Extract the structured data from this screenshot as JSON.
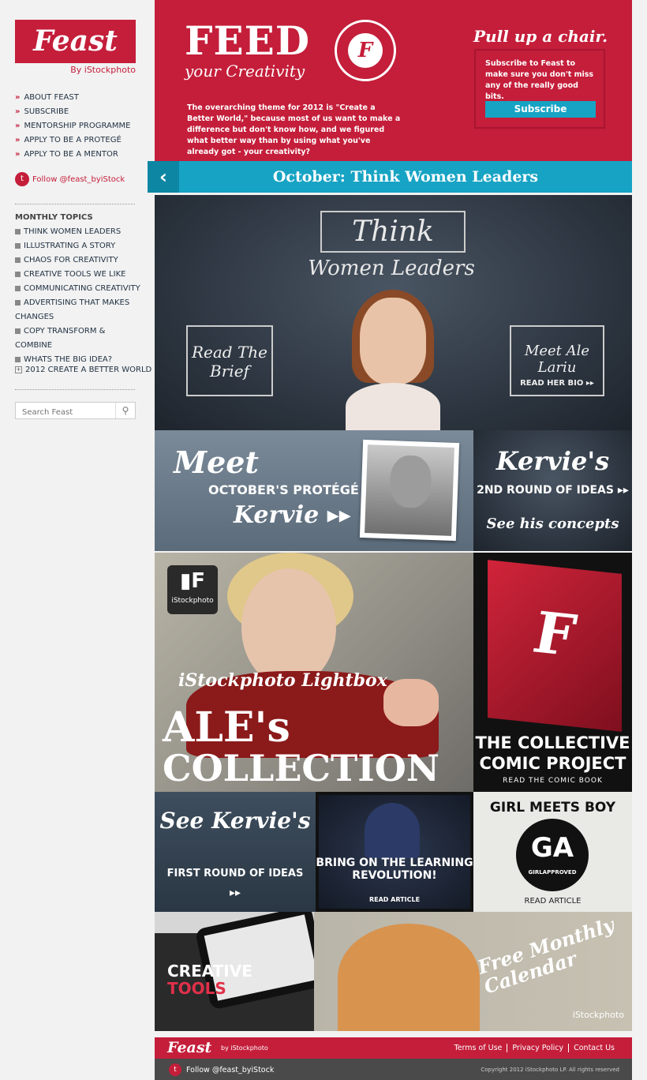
{
  "sidebar": {
    "logo": "Feast",
    "logo_sub": "By iStockphoto",
    "nav": [
      {
        "label": "ABOUT FEAST"
      },
      {
        "label": "SUBSCRIBE"
      },
      {
        "label": "MENTORSHIP PROGRAMME"
      },
      {
        "label": "APPLY TO BE A PROTEGÉ"
      },
      {
        "label": "APPLY TO BE A MENTOR"
      }
    ],
    "follow": "Follow @feast_byiStock",
    "topics_heading": "MONTHLY TOPICS",
    "topics": [
      {
        "label": "THINK WOMEN LEADERS"
      },
      {
        "label": "ILLUSTRATING A STORY"
      },
      {
        "label": "CHAOS FOR CREATIVITY"
      },
      {
        "label": "CREATIVE TOOLS WE LIKE"
      },
      {
        "label": "COMMUNICATING CREATIVITY"
      },
      {
        "label": "ADVERTISING THAT MAKES CHANGES"
      },
      {
        "label": "COPY TRANSFORM & COMBINE"
      },
      {
        "label": "WHATS THE BIG IDEA?"
      }
    ],
    "create_world": "2012 CREATE A BETTER WORLD",
    "search_placeholder": "Search Feast"
  },
  "header": {
    "title": "FEED",
    "subtitle": "your Creativity",
    "intro": "The overarching theme for 2012 is \"Create a Better World,\" because most of us want to make a difference but don't know how, and we figured what better way than by using what you've already got - your creativity?",
    "pull_up": "Pull up a chair.",
    "subscribe_text": "Subscribe to Feast to make sure you don't miss any of the really good bits.",
    "subscribe_button": "Subscribe"
  },
  "month_bar": {
    "title": "October: Think Women Leaders",
    "prev": "‹"
  },
  "hero": {
    "think": "Think",
    "women_leaders": "Women Leaders",
    "brief": "Read The Brief",
    "meet": "Meet Ale Lariu",
    "bio": "READ HER BIO ▸▸"
  },
  "protege": {
    "meet": "Meet",
    "octobers": "OCTOBER'S PROTÉGÉ",
    "name": "Kervie ▸▸"
  },
  "round2": {
    "name": "Kervie's",
    "line": "2ND ROUND OF IDEAS ▸▸",
    "see": "See his concepts"
  },
  "ale": {
    "badge": "iStockphoto",
    "line1": "iStockphoto Lightbox",
    "line2": "ALE's",
    "line3": "COLLECTION"
  },
  "comic": {
    "title": "THE COLLECTIVE COMIC PROJECT",
    "sub": "READ THE COMIC BOOK"
  },
  "see": {
    "title": "See Kervie's",
    "sub": "FIRST ROUND OF IDEAS",
    "arrows": "▸▸"
  },
  "learn": {
    "title": "BRING ON THE LEARNING REVOLUTION!",
    "sub": "READ ARTICLE"
  },
  "gmb": {
    "title": "GIRL MEETS BOY",
    "seal": "GA",
    "seal_sub": "GIRLAPPROVED",
    "sub": "READ ARTICLE"
  },
  "tools": {
    "line1": "CREATIVE",
    "line2": "TOOLS"
  },
  "calendar": {
    "title": "Free Monthly Calendar",
    "brand": "iStockphoto"
  },
  "footer": {
    "logo": "Feast",
    "by": "by iStockphoto",
    "links": [
      {
        "label": "Terms of Use"
      },
      {
        "label": "Privacy Policy"
      },
      {
        "label": "Contact Us"
      }
    ],
    "follow": "Follow @feast_byiStock",
    "copyright": "Copyright 2012 iStockphoto LP. All rights reserved"
  }
}
